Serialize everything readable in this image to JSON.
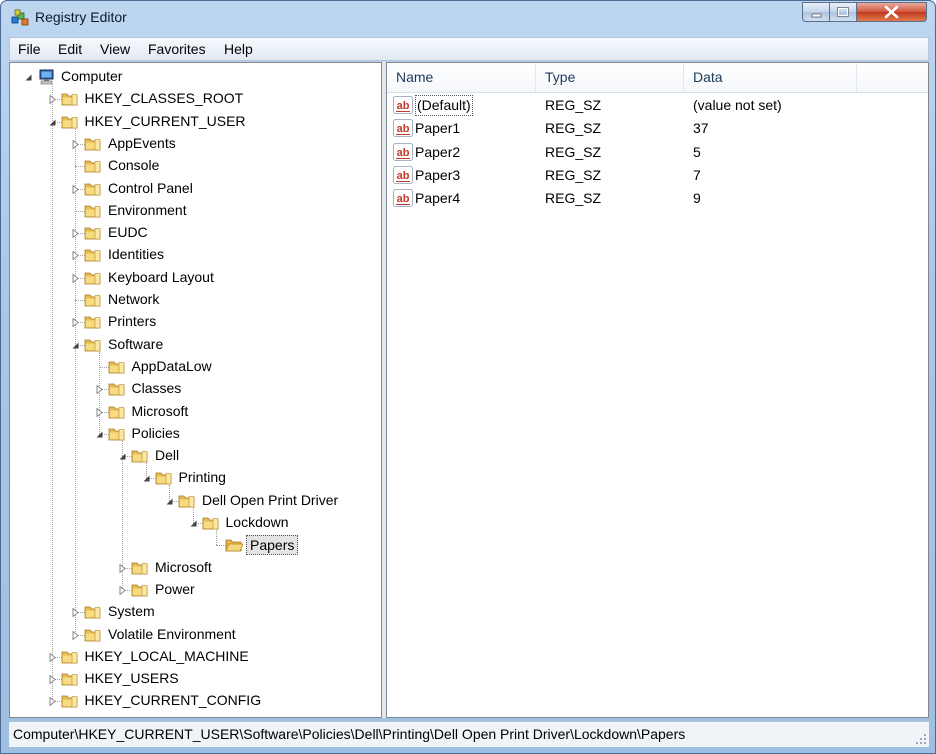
{
  "window": {
    "title": "Registry Editor"
  },
  "menu": [
    "File",
    "Edit",
    "View",
    "Favorites",
    "Help"
  ],
  "tree": [
    {
      "label": "Computer",
      "depth": 0,
      "expander": "expanded",
      "icon": "computer-icon"
    },
    {
      "label": "HKEY_CLASSES_ROOT",
      "depth": 1,
      "expander": "collapsed",
      "icon": "folder-icon"
    },
    {
      "label": "HKEY_CURRENT_USER",
      "depth": 1,
      "expander": "expanded",
      "icon": "folder-icon"
    },
    {
      "label": "AppEvents",
      "depth": 2,
      "expander": "collapsed",
      "icon": "folder-icon"
    },
    {
      "label": "Console",
      "depth": 2,
      "expander": "none",
      "icon": "folder-icon"
    },
    {
      "label": "Control Panel",
      "depth": 2,
      "expander": "collapsed",
      "icon": "folder-icon"
    },
    {
      "label": "Environment",
      "depth": 2,
      "expander": "none",
      "icon": "folder-icon"
    },
    {
      "label": "EUDC",
      "depth": 2,
      "expander": "collapsed",
      "icon": "folder-icon"
    },
    {
      "label": "Identities",
      "depth": 2,
      "expander": "collapsed",
      "icon": "folder-icon"
    },
    {
      "label": "Keyboard Layout",
      "depth": 2,
      "expander": "collapsed",
      "icon": "folder-icon"
    },
    {
      "label": "Network",
      "depth": 2,
      "expander": "none",
      "icon": "folder-icon"
    },
    {
      "label": "Printers",
      "depth": 2,
      "expander": "collapsed",
      "icon": "folder-icon"
    },
    {
      "label": "Software",
      "depth": 2,
      "expander": "expanded",
      "icon": "folder-icon"
    },
    {
      "label": "AppDataLow",
      "depth": 3,
      "expander": "none",
      "icon": "folder-icon"
    },
    {
      "label": "Classes",
      "depth": 3,
      "expander": "collapsed",
      "icon": "folder-icon"
    },
    {
      "label": "Microsoft",
      "depth": 3,
      "expander": "collapsed",
      "icon": "folder-icon"
    },
    {
      "label": "Policies",
      "depth": 3,
      "expander": "expanded",
      "icon": "folder-icon"
    },
    {
      "label": "Dell",
      "depth": 4,
      "expander": "expanded",
      "icon": "folder-icon"
    },
    {
      "label": "Printing",
      "depth": 5,
      "expander": "expanded",
      "icon": "folder-icon"
    },
    {
      "label": "Dell Open Print Driver",
      "depth": 6,
      "expander": "expanded",
      "icon": "folder-icon"
    },
    {
      "label": "Lockdown",
      "depth": 7,
      "expander": "expanded",
      "icon": "folder-icon"
    },
    {
      "label": "Papers",
      "depth": 8,
      "expander": "none",
      "icon": "folder-open-icon",
      "selected": true
    },
    {
      "label": "Microsoft",
      "depth": 4,
      "expander": "collapsed",
      "icon": "folder-icon"
    },
    {
      "label": "Power",
      "depth": 4,
      "expander": "collapsed",
      "icon": "folder-icon"
    },
    {
      "label": "System",
      "depth": 2,
      "expander": "collapsed",
      "icon": "folder-icon"
    },
    {
      "label": "Volatile Environment",
      "depth": 2,
      "expander": "collapsed",
      "icon": "folder-icon"
    },
    {
      "label": "HKEY_LOCAL_MACHINE",
      "depth": 1,
      "expander": "collapsed",
      "icon": "folder-icon"
    },
    {
      "label": "HKEY_USERS",
      "depth": 1,
      "expander": "collapsed",
      "icon": "folder-icon"
    },
    {
      "label": "HKEY_CURRENT_CONFIG",
      "depth": 1,
      "expander": "collapsed",
      "icon": "folder-icon"
    }
  ],
  "list": {
    "columns": [
      "Name",
      "Type",
      "Data"
    ],
    "rows": [
      {
        "name": "(Default)",
        "type": "REG_SZ",
        "data": "(value not set)",
        "icon": "string-value-icon",
        "focused": true
      },
      {
        "name": "Paper1",
        "type": "REG_SZ",
        "data": "37",
        "icon": "string-value-icon"
      },
      {
        "name": "Paper2",
        "type": "REG_SZ",
        "data": "5",
        "icon": "string-value-icon"
      },
      {
        "name": "Paper3",
        "type": "REG_SZ",
        "data": "7",
        "icon": "string-value-icon"
      },
      {
        "name": "Paper4",
        "type": "REG_SZ",
        "data": "9",
        "icon": "string-value-icon"
      }
    ]
  },
  "status": {
    "path": "Computer\\HKEY_CURRENT_USER\\Software\\Policies\\Dell\\Printing\\Dell Open Print Driver\\Lockdown\\Papers"
  },
  "colors": {
    "title_bar": "#a9c7e8",
    "close_button": "#c0391f",
    "selection": "#e4e4e4",
    "header_text": "#1e395b"
  }
}
